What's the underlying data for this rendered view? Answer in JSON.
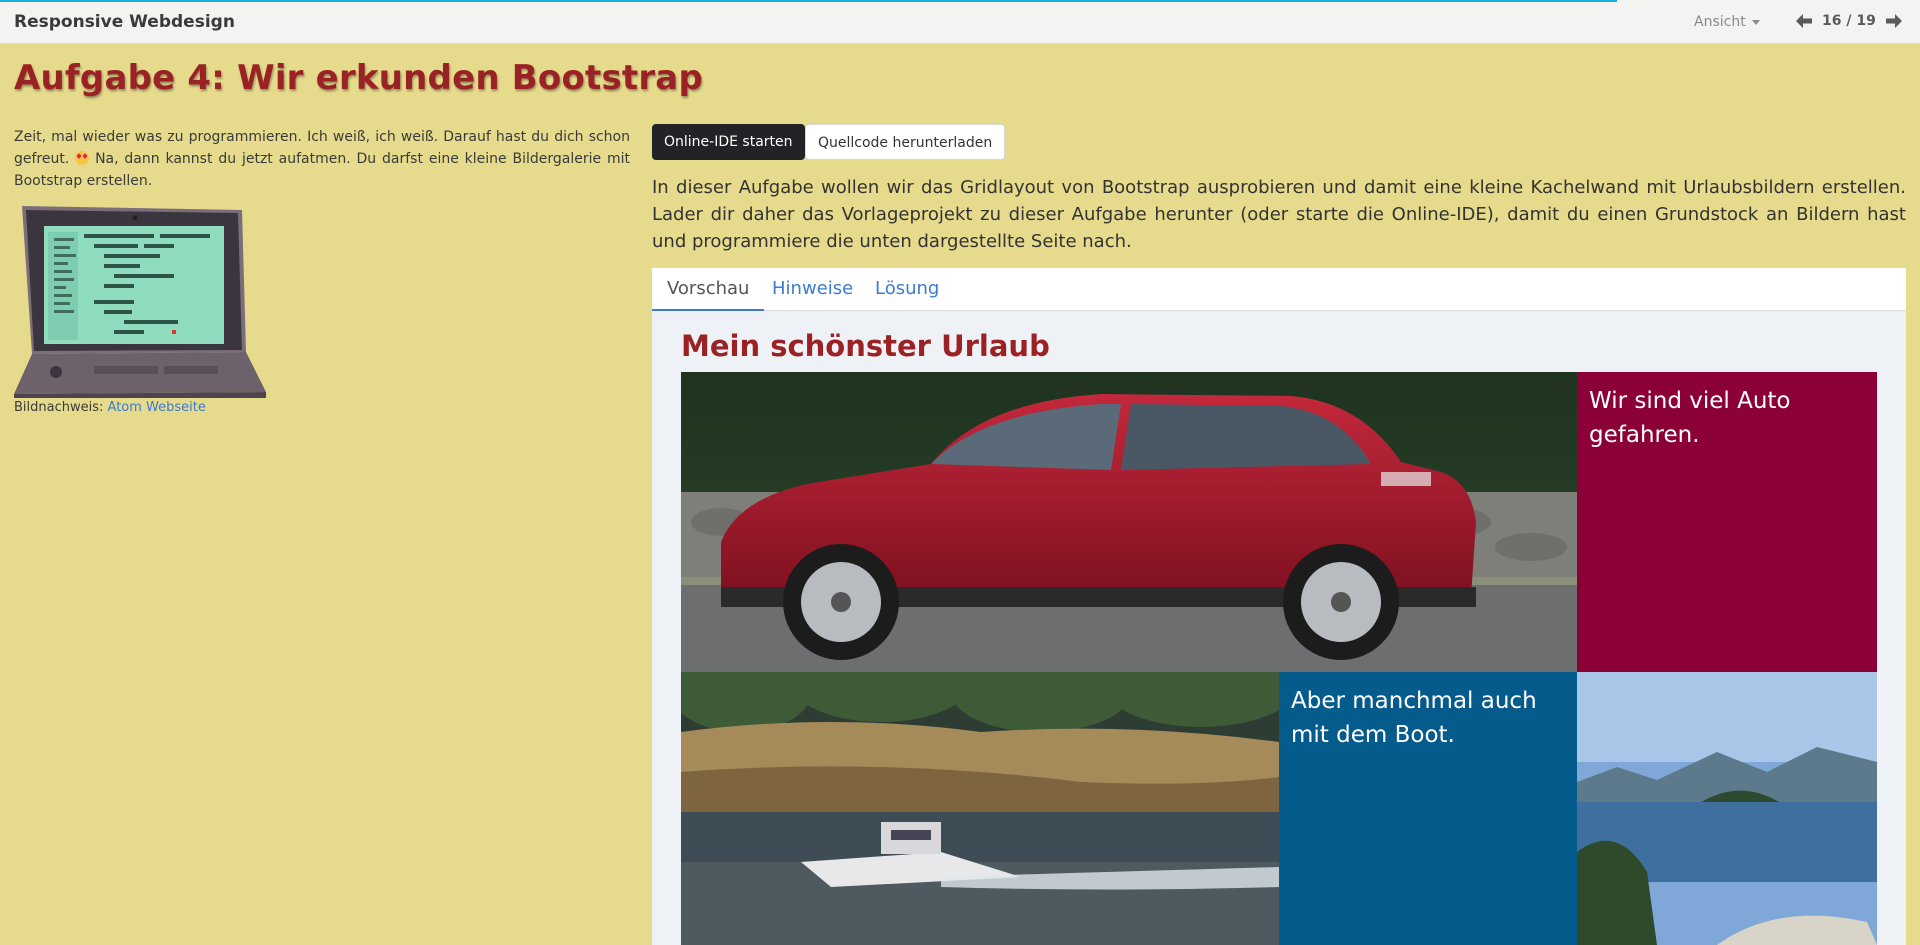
{
  "navbar": {
    "brand": "Responsive Webdesign",
    "view_menu": "Ansicht",
    "page_counter": "16 / 19",
    "progress_fraction": 0.842,
    "progress_color": "#1ab0e0",
    "prev_icon": "arrow-left-icon",
    "next_icon": "arrow-right-icon"
  },
  "left": {
    "title": "Aufgabe 4: Wir erkunden Bootstrap",
    "intro_part1": "Zeit, mal wieder was zu programmieren. Ich weiß, ich weiß. Darauf hast du dich schon ge­freut.",
    "intro_emoji": "heart-eyes-emoji",
    "intro_part2": "Na, dann kannst du jetzt aufatmen. Du darfst eine kleine Bildergalerie mit Boot­strap erstellen.",
    "image_icon": "laptop-illustration",
    "credit_label": "Bildnachweis:",
    "credit_link": "Atom Webseite"
  },
  "right": {
    "btn_ide": "Online-IDE starten",
    "btn_download": "Quellcode herunterladen",
    "task_text": "In dieser Aufgabe wollen wir das Gridlayout von Bootstrap ausprobieren und damit eine kleine Kachelwand mit Urlaubsbildern erstellen. Lader dir daher das Vorlageprojekt zu dieser Aufgabe herunter (oder starte die Online-IDE), damit du einen Grundstock an Bildern hast und programmiere die unten dar­gestellte Seite nach.",
    "tabs": [
      {
        "label": "Vorschau",
        "active": true
      },
      {
        "label": "Hinweise",
        "active": false
      },
      {
        "label": "Lösung",
        "active": false
      }
    ]
  },
  "preview": {
    "heading": "Mein schönster Urlaub",
    "tiles": {
      "car_image": "red-suv-photo",
      "car_text": "Wir sind viel Auto gefah­ren.",
      "car_text_color": "#8c0038",
      "boat_image": "motorboat-photo",
      "boat_text": "Aber manchmal auch mit dem Boot.",
      "boat_text_color": "#045b8c",
      "lake_image": "lake-islands-photo"
    }
  },
  "colors": {
    "page_bg": "#e6db8c",
    "title_red": "#9b2224",
    "link_blue": "#3b7bd4"
  }
}
